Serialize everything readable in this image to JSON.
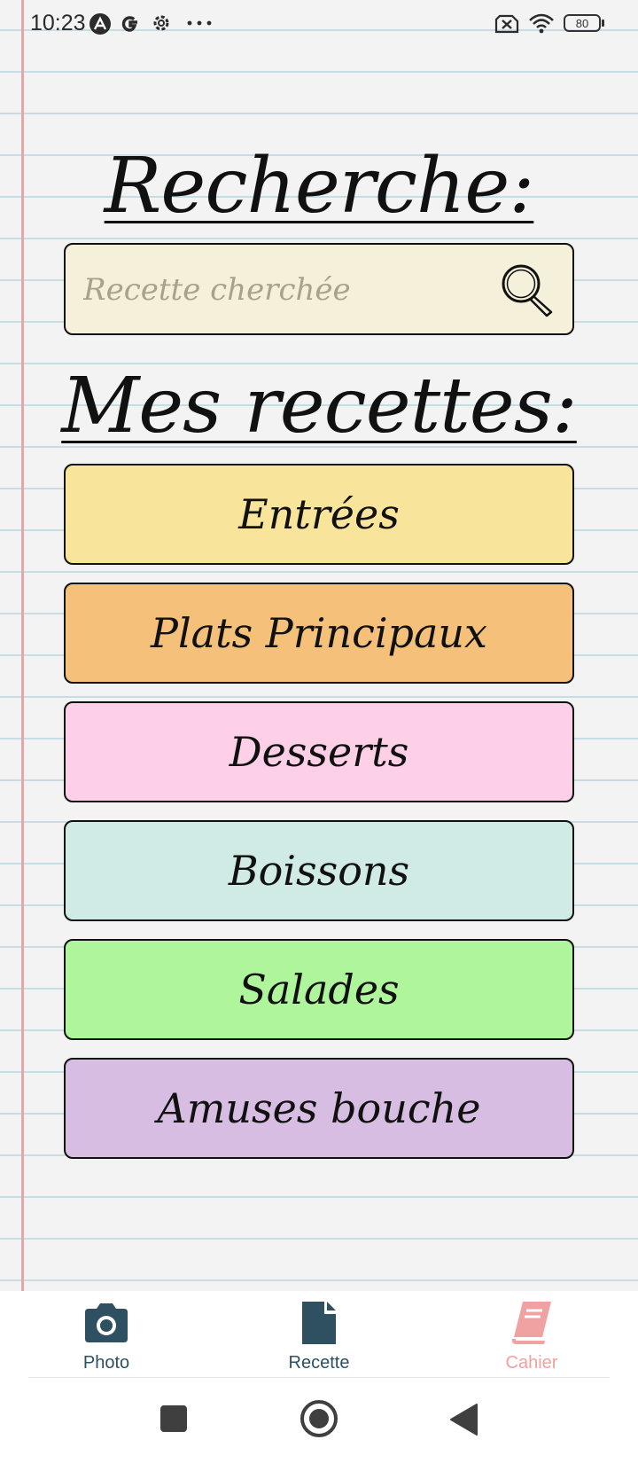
{
  "status_bar": {
    "time": "10:23",
    "battery": "80"
  },
  "search": {
    "title": "Recherche:",
    "placeholder": "Recette cherchée"
  },
  "recipes": {
    "title": "Mes recettes:",
    "categories": [
      {
        "label": "Entrées",
        "color": "#f8e59b"
      },
      {
        "label": "Plats Principaux",
        "color": "#f5c07a"
      },
      {
        "label": "Desserts",
        "color": "#fdd0e7"
      },
      {
        "label": "Boissons",
        "color": "#d0ebe5"
      },
      {
        "label": "Salades",
        "color": "#aef59b"
      },
      {
        "label": "Amuses bouche",
        "color": "#d6bde1"
      }
    ]
  },
  "bottom_nav": {
    "items": [
      {
        "label": "Photo",
        "icon": "camera-icon",
        "active": false
      },
      {
        "label": "Recette",
        "icon": "file-icon",
        "active": false
      },
      {
        "label": "Cahier",
        "icon": "book-icon",
        "active": true
      }
    ],
    "colors": {
      "inactive": "#2f5061",
      "active": "#f0a1a1"
    }
  },
  "system_nav": [
    "square-icon",
    "home-circle-icon",
    "back-triangle-icon"
  ]
}
